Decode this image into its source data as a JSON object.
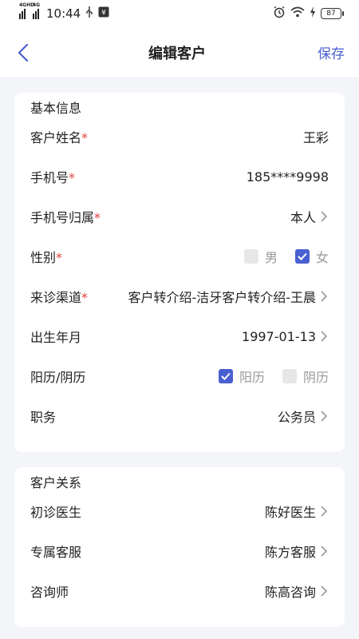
{
  "status": {
    "time": "10:44",
    "net1": "4GHD",
    "net2": "4G",
    "battery": "87"
  },
  "header": {
    "title": "编辑客户",
    "save": "保存"
  },
  "basic": {
    "title": "基本信息",
    "name_label": "客户姓名",
    "name_value": "王彩",
    "phone_label": "手机号",
    "phone_value": "185****9998",
    "owner_label": "手机号归属",
    "owner_value": "本人",
    "gender_label": "性别",
    "gender_male": "男",
    "gender_female": "女",
    "gender_selected": "女",
    "channel_label": "来诊渠道",
    "channel_value": "客户转介绍-洁牙客户转介绍-王晨",
    "birth_label": "出生年月",
    "birth_value": "1997-01-13",
    "cal_label": "阳历/阴历",
    "cal_solar": "阳历",
    "cal_lunar": "阴历",
    "cal_selected": "阳历",
    "job_label": "职务",
    "job_value": "公务员",
    "required_mark": "*"
  },
  "relation": {
    "title": "客户关系",
    "doctor_label": "初诊医生",
    "doctor_value": "陈好医生",
    "service_label": "专属客服",
    "service_value": "陈方客服",
    "consult_label": "咨询师",
    "consult_value": "陈高咨询"
  },
  "colors": {
    "accent": "#4a5fd0",
    "required": "#e04040"
  }
}
